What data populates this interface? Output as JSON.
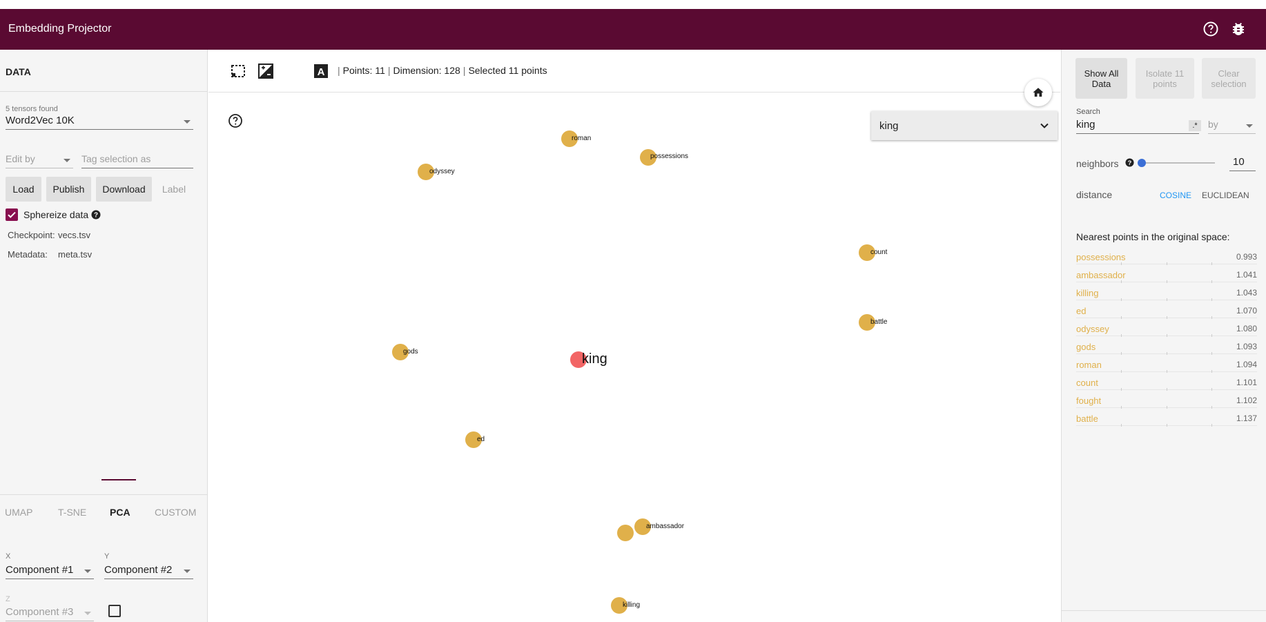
{
  "header": {
    "title": "Embedding Projector"
  },
  "left": {
    "section_title": "DATA",
    "tensors_found": "5 tensors found",
    "tensor_selected": "Word2Vec 10K",
    "edit_by": "Edit by",
    "tag_selection_placeholder": "Tag selection as",
    "buttons": {
      "load": "Load",
      "publish": "Publish",
      "download": "Download",
      "label": "Label"
    },
    "sphereize_label": "Sphereize data",
    "sphereize_checked": true,
    "checkpoint_label": "Checkpoint:",
    "checkpoint_value": "vecs.tsv",
    "metadata_label": "Metadata:",
    "metadata_value": "meta.tsv",
    "tabs": [
      "UMAP",
      "T-SNE",
      "PCA",
      "CUSTOM"
    ],
    "active_tab": "PCA",
    "x_label": "X",
    "x_value": "Component #1",
    "y_label": "Y",
    "y_value": "Component #2",
    "z_label": "Z",
    "z_value": "Component #3"
  },
  "toolbar": {
    "points": "Points: 11",
    "dimension": "Dimension: 128",
    "selected": "Selected 11 points"
  },
  "canvas": {
    "label_by": "king",
    "points": [
      {
        "label": "roman",
        "selected": false
      },
      {
        "label": "possessions",
        "selected": false
      },
      {
        "label": "odyssey",
        "selected": false
      },
      {
        "label": "count",
        "selected": false
      },
      {
        "label": "battle",
        "selected": false
      },
      {
        "label": "gods",
        "selected": false
      },
      {
        "label": "king",
        "selected": true
      },
      {
        "label": "ed",
        "selected": false
      },
      {
        "label": "ambassador",
        "selected": false
      },
      {
        "label": "killing",
        "selected": false
      }
    ]
  },
  "right": {
    "show_all": "Show All Data",
    "isolate": "Isolate 11 points",
    "clear": "Clear selection",
    "search_label": "Search",
    "search_value": "king",
    "regex_toggle": ".*",
    "by_label": "by",
    "neighbors_label": "neighbors",
    "neighbors_value": "10",
    "distance_label": "distance",
    "cosine": "COSINE",
    "euclidean": "EUCLIDEAN",
    "nn_title": "Nearest points in the original space:",
    "neighbors": [
      {
        "word": "possessions",
        "value": "0.993"
      },
      {
        "word": "ambassador",
        "value": "1.041"
      },
      {
        "word": "killing",
        "value": "1.043"
      },
      {
        "word": "ed",
        "value": "1.070"
      },
      {
        "word": "odyssey",
        "value": "1.080"
      },
      {
        "word": "gods",
        "value": "1.093"
      },
      {
        "word": "roman",
        "value": "1.094"
      },
      {
        "word": "count",
        "value": "1.101"
      },
      {
        "word": "fought",
        "value": "1.102"
      },
      {
        "word": "battle",
        "value": "1.137"
      }
    ]
  },
  "colors": {
    "header": "#5a0a32",
    "point": "#e0b04a",
    "selected_point": "#f26565",
    "accent_blue": "#2196f3"
  }
}
